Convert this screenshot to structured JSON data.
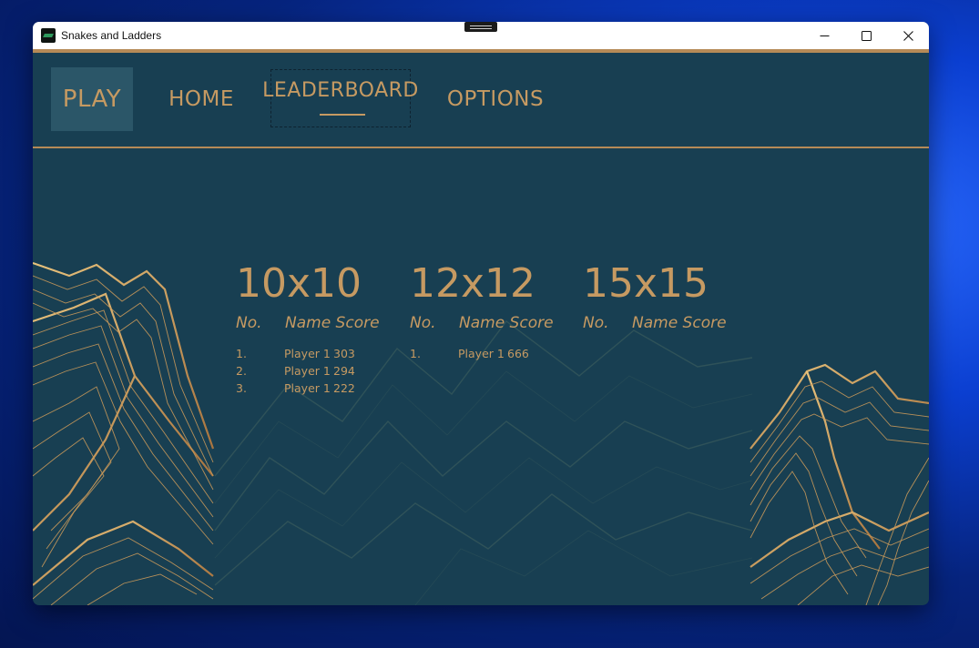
{
  "window": {
    "title": "Snakes and Ladders"
  },
  "nav": {
    "play": "PLAY",
    "home": "HOME",
    "leaderboard": "LEADERBOARD",
    "options": "OPTIONS"
  },
  "boards": [
    {
      "title": "10x10",
      "headers": {
        "no": "No.",
        "name_score": "Name Score"
      },
      "rows": [
        {
          "no": "1.",
          "name": "Player 1",
          "score": "303"
        },
        {
          "no": "2.",
          "name": "Player 1",
          "score": "294"
        },
        {
          "no": "3.",
          "name": "Player 1",
          "score": "222"
        }
      ]
    },
    {
      "title": "12x12",
      "headers": {
        "no": "No.",
        "name_score": "Name Score"
      },
      "rows": [
        {
          "no": "1.",
          "name": "Player 1",
          "score": "666"
        }
      ]
    },
    {
      "title": "15x15",
      "headers": {
        "no": "No.",
        "name_score": "Name Score"
      },
      "rows": []
    }
  ],
  "colors": {
    "background": "#183f52",
    "gold": "#c69a62",
    "play_highlight": "#2b5668",
    "desktop": "#0b3fd1"
  },
  "icons": [
    "app-icon",
    "minimize-icon",
    "maximize-icon",
    "close-icon"
  ]
}
